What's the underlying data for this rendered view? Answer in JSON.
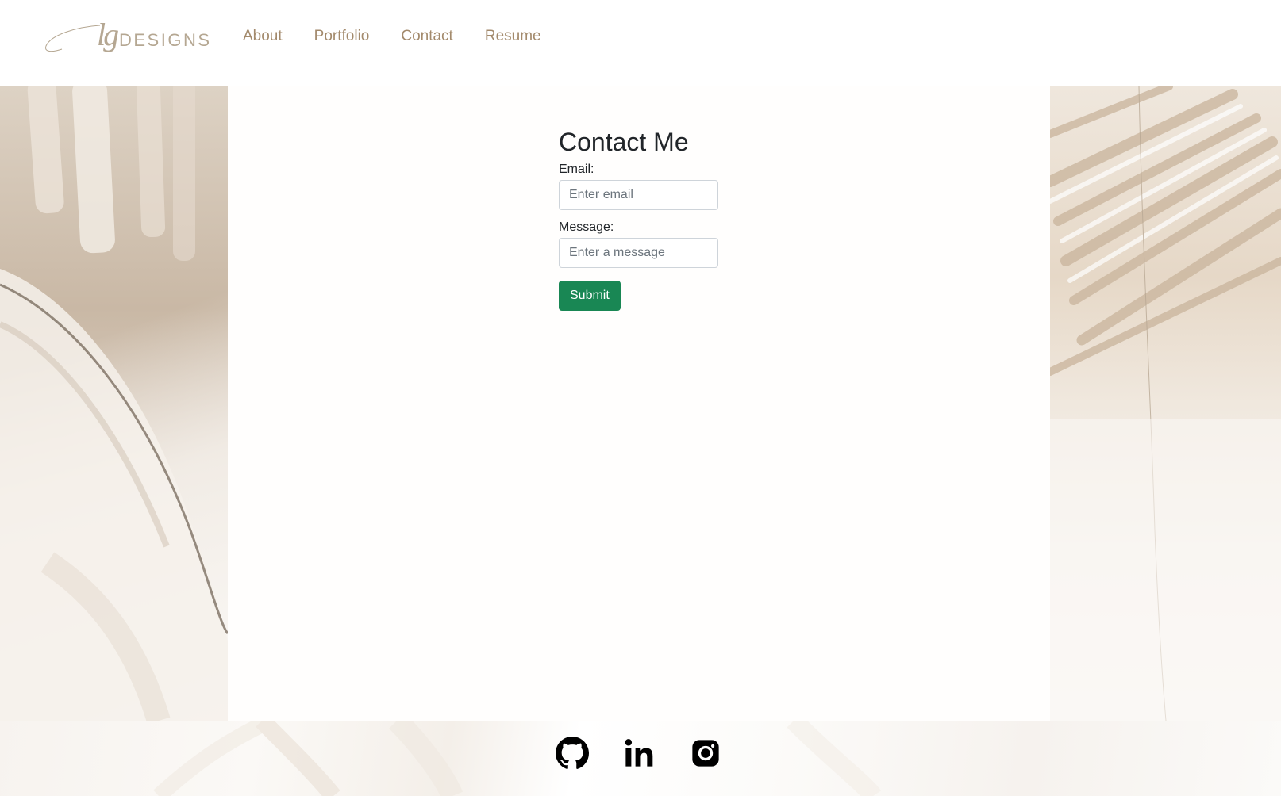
{
  "brand": {
    "script": "lg",
    "wordmark": "DESIGNS",
    "color": "#b5a792"
  },
  "nav": {
    "items": [
      {
        "label": "About"
      },
      {
        "label": "Portfolio"
      },
      {
        "label": "Contact"
      },
      {
        "label": "Resume"
      }
    ],
    "color": "#a38a6c"
  },
  "contact_form": {
    "title": "Contact Me",
    "email_label": "Email:",
    "email_placeholder": "Enter email",
    "email_value": "",
    "message_label": "Message:",
    "message_placeholder": "Enter a message",
    "message_value": "",
    "submit_label": "Submit",
    "submit_color": "#198754"
  },
  "footer": {
    "social": [
      {
        "icon": "github-icon"
      },
      {
        "icon": "linkedin-icon"
      },
      {
        "icon": "instagram-icon"
      }
    ]
  }
}
